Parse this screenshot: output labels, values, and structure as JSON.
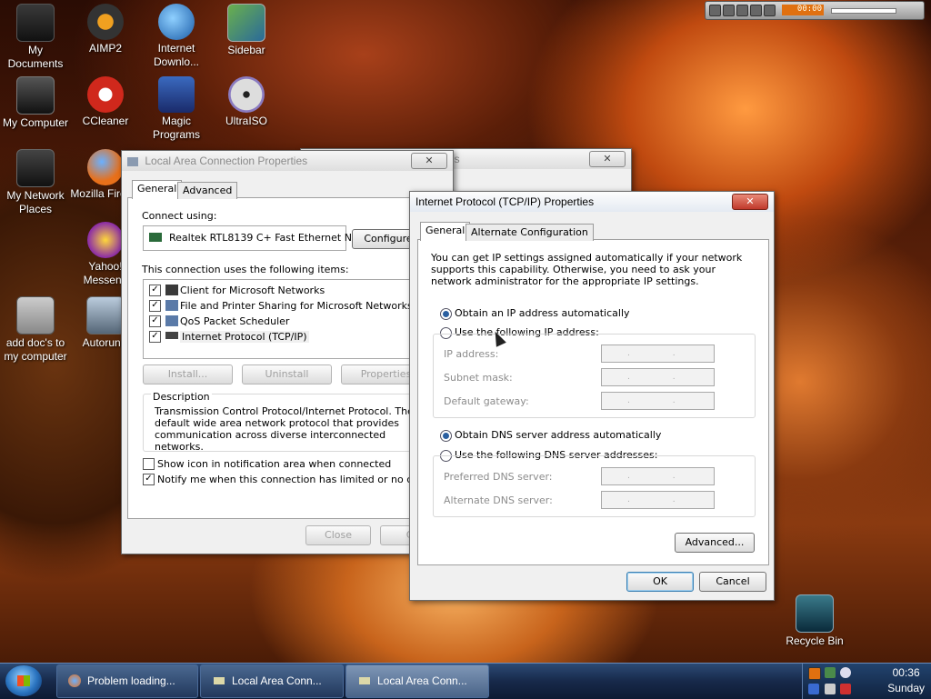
{
  "desktop": {
    "icons": [
      {
        "label": "My Documents",
        "icon": "my-documents-icon"
      },
      {
        "label": "AIMP2",
        "icon": "aimp-icon"
      },
      {
        "label": "Internet Downlo...",
        "icon": "internet-download-icon"
      },
      {
        "label": "Sidebar",
        "icon": "sidebar-icon"
      },
      {
        "label": "My Computer",
        "icon": "computer-icon"
      },
      {
        "label": "CCleaner",
        "icon": "ccleaner-icon"
      },
      {
        "label": "Magic Programs",
        "icon": "magic-programs-icon"
      },
      {
        "label": "UltraISO",
        "icon": "ultraiso-icon"
      },
      {
        "label": "My Network Places",
        "icon": "network-places-icon"
      },
      {
        "label": "Mozilla Firefox",
        "icon": "firefox-icon"
      },
      {
        "label": "Yahoo! Messeng",
        "icon": "yahoo-messenger-icon"
      },
      {
        "label": "add doc's to my computer",
        "icon": "floppy-icon"
      },
      {
        "label": "AutorunR",
        "icon": "autorun-icon"
      },
      {
        "label": "Recycle Bin",
        "icon": "recycle-bin-icon"
      }
    ]
  },
  "player": {
    "time": "00:00"
  },
  "win_back": {
    "title_fragment": "us",
    "close": "✕"
  },
  "lac": {
    "title": "Local Area Connection Properties",
    "close": "✕",
    "tabs": [
      "General",
      "Advanced"
    ],
    "connect_using": "Connect using:",
    "adapter": "Realtek RTL8139 C+ Fast Ethernet N",
    "configure": "Configure",
    "items_label": "This connection uses the following items:",
    "items": [
      {
        "label": "Client for Microsoft Networks",
        "checked": true
      },
      {
        "label": "File and Printer Sharing for Microsoft Networks",
        "checked": true
      },
      {
        "label": "QoS Packet Scheduler",
        "checked": true
      },
      {
        "label": "Internet Protocol (TCP/IP)",
        "checked": true
      }
    ],
    "install": "Install...",
    "uninstall": "Uninstall",
    "properties": "Properties",
    "description_title": "Description",
    "description": "Transmission Control Protocol/Internet Protocol. The default wide area network protocol that provides communication across diverse interconnected networks.",
    "show_icon": "Show icon in notification area when connected",
    "notify": "Notify me when this connection has limited or no connectivi",
    "close_btn": "Close",
    "cancel_btn": "Ca"
  },
  "tcp": {
    "title": "Internet Protocol (TCP/IP) Properties",
    "close": "✕",
    "tabs": [
      "General",
      "Alternate Configuration"
    ],
    "intro": "You can get IP settings assigned automatically if your network supports this capability. Otherwise, you need to ask your network administrator for the appropriate IP settings.",
    "obtain_ip": "Obtain an IP address automatically",
    "use_ip": "Use the following IP address:",
    "ip_address": "IP address:",
    "subnet": "Subnet mask:",
    "gateway": "Default gateway:",
    "obtain_dns": "Obtain DNS server address automatically",
    "use_dns": "Use the following DNS server addresses:",
    "preferred_dns": "Preferred DNS server:",
    "alternate_dns": "Alternate DNS server:",
    "ip_placeholder": ". . .",
    "advanced": "Advanced...",
    "ok": "OK",
    "cancel": "Cancel"
  },
  "taskbar": {
    "buttons": [
      {
        "label": "Problem loading...",
        "icon": "firefox-icon"
      },
      {
        "label": "Local Area Conn...",
        "icon": "network-icon"
      },
      {
        "label": "Local Area Conn...",
        "icon": "network-icon"
      }
    ],
    "time": "00:36",
    "day": "Sunday"
  }
}
